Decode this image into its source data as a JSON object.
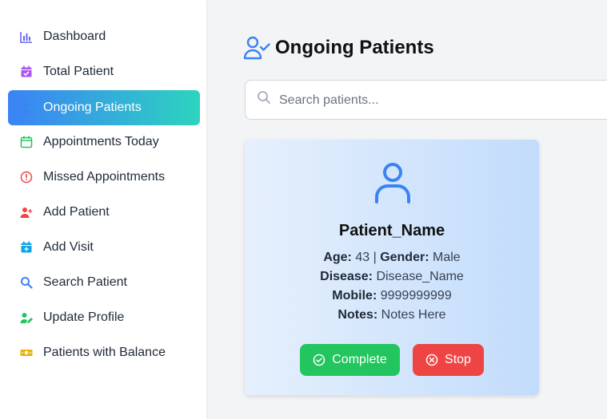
{
  "sidebar": {
    "items": [
      {
        "label": "Dashboard",
        "icon": "bar-chart-icon",
        "color": "#6366f1"
      },
      {
        "label": "Total Patient",
        "icon": "calendar-check-icon",
        "color": "#a855f7"
      },
      {
        "label": "Ongoing Patients",
        "icon": "user-check-icon",
        "color": "#3b82f6",
        "active": true
      },
      {
        "label": "Appointments Today",
        "icon": "calendar-icon",
        "color": "#22c55e"
      },
      {
        "label": "Missed Appointments",
        "icon": "alert-circle-icon",
        "color": "#ef4444"
      },
      {
        "label": "Add Patient",
        "icon": "user-plus-icon",
        "color": "#ef4444"
      },
      {
        "label": "Add Visit",
        "icon": "calendar-plus-icon",
        "color": "#0ea5e9"
      },
      {
        "label": "Search Patient",
        "icon": "search-icon",
        "color": "#3b82f6"
      },
      {
        "label": "Update Profile",
        "icon": "user-edit-icon",
        "color": "#22c55e"
      },
      {
        "label": "Patients with Balance",
        "icon": "money-icon",
        "color": "#eab308"
      }
    ]
  },
  "main": {
    "title": "Ongoing Patients",
    "search": {
      "placeholder": "Search patients...",
      "value": ""
    },
    "card": {
      "name": "Patient_Name",
      "age_label": "Age:",
      "age": "43",
      "separator": "|",
      "gender_label": "Gender:",
      "gender": "Male",
      "disease_label": "Disease:",
      "disease": "Disease_Name",
      "mobile_label": "Mobile:",
      "mobile": "9999999999",
      "notes_label": "Notes:",
      "notes": "Notes Here",
      "complete_label": "Complete",
      "stop_label": "Stop"
    }
  },
  "colors": {
    "active_gradient_start": "#3b82f6",
    "active_gradient_end": "#2dd4bf",
    "complete": "#22c55e",
    "stop": "#ef4444",
    "accent": "#3b82f6"
  }
}
